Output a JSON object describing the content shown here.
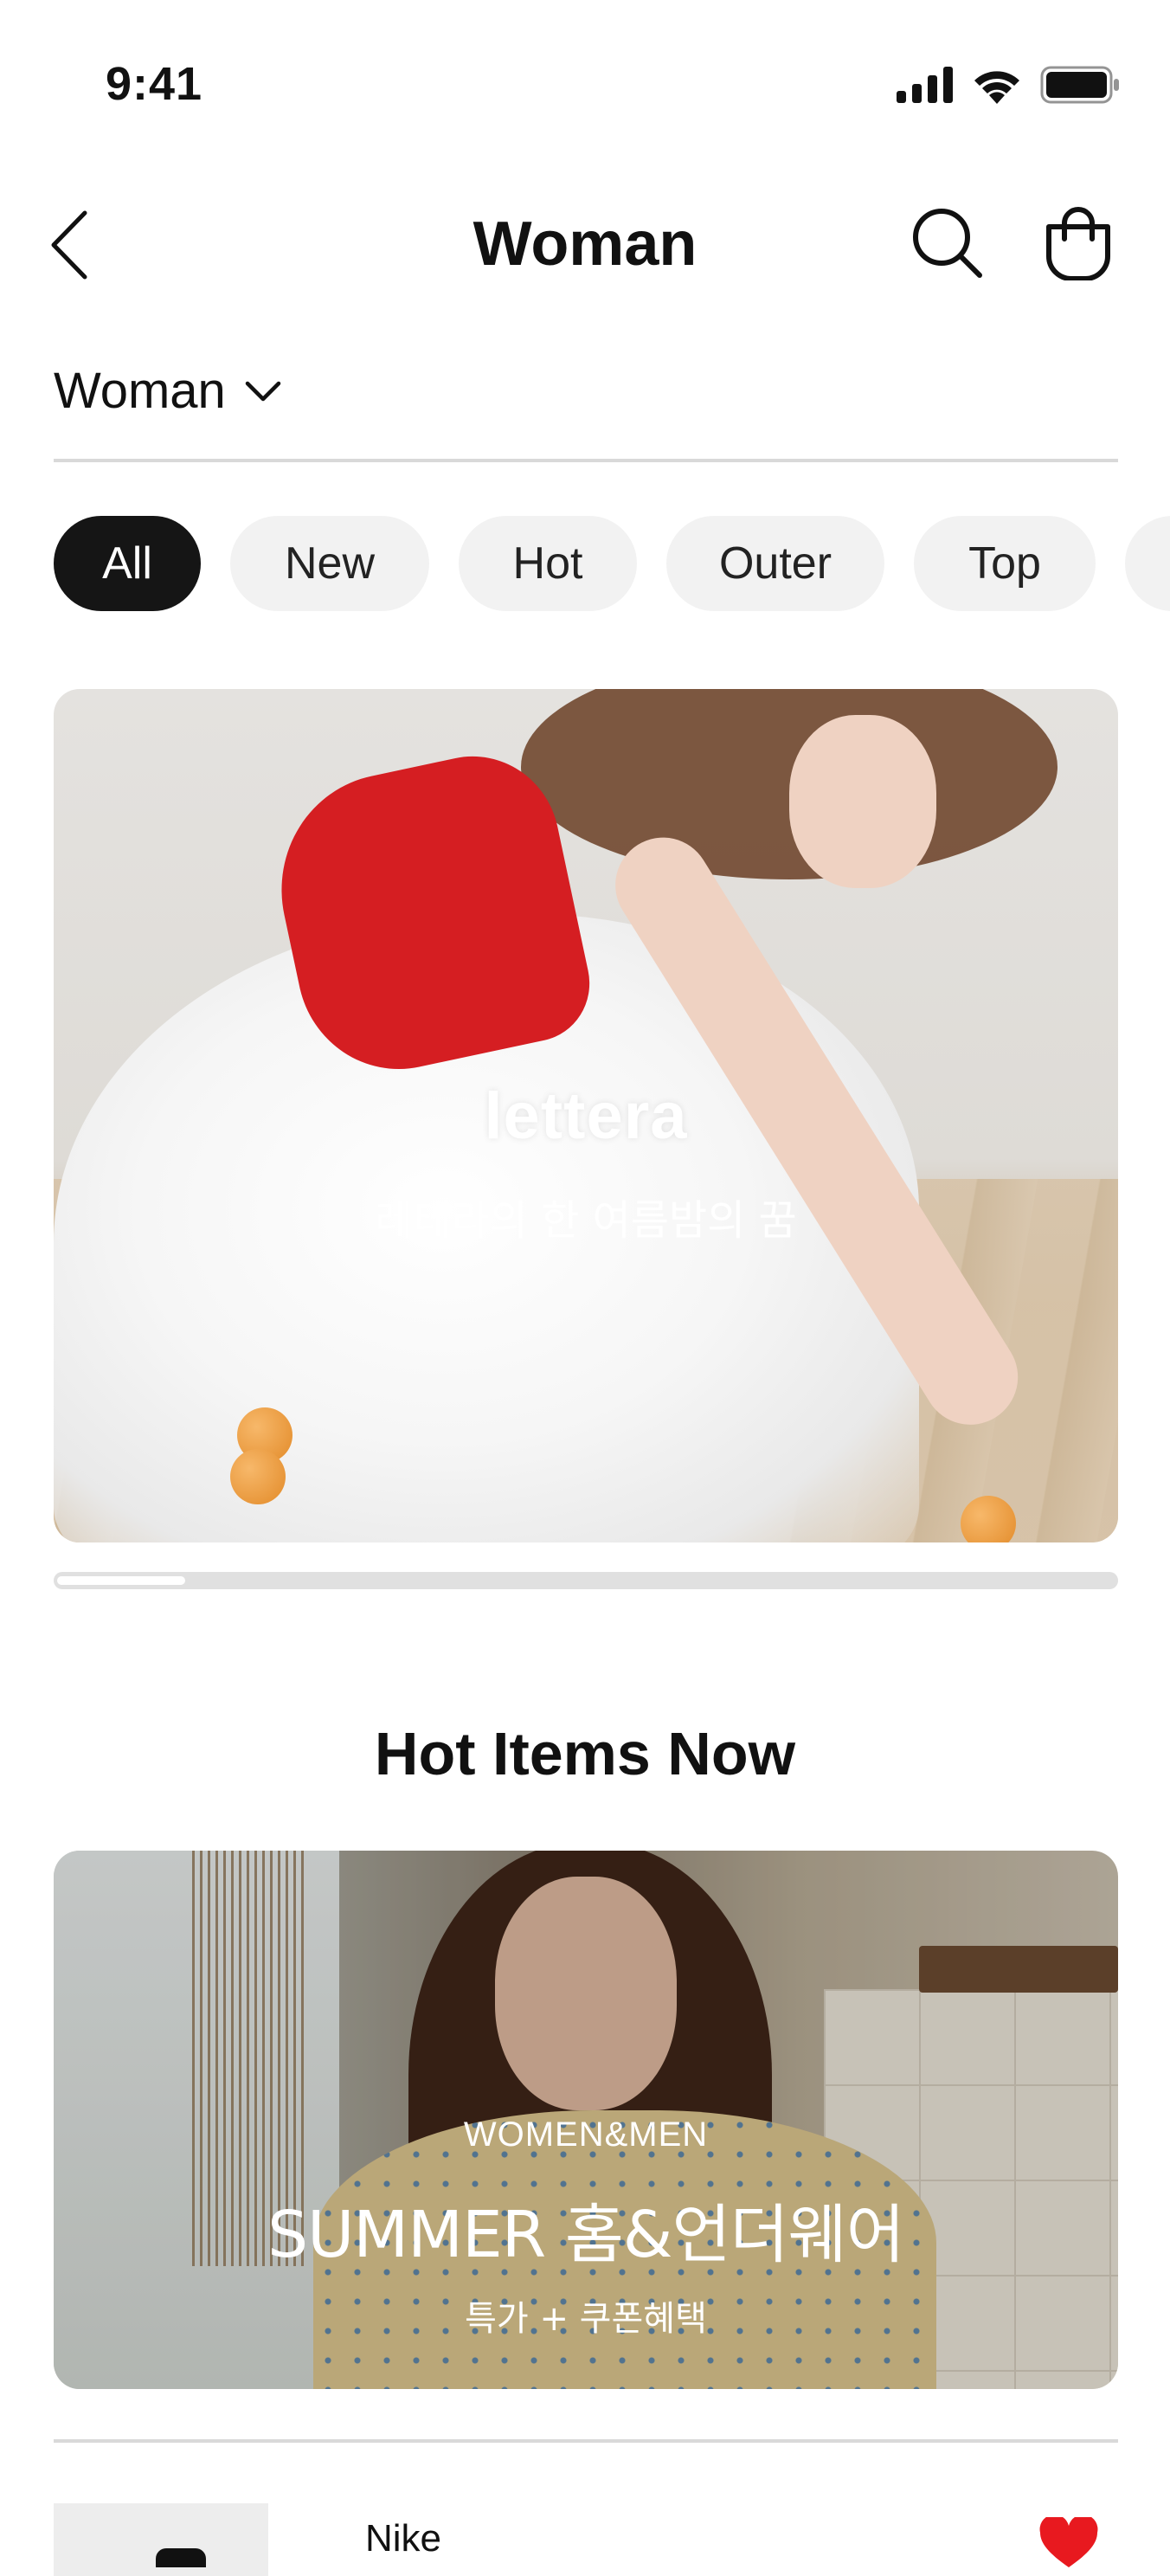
{
  "status_bar": {
    "time": "9:41"
  },
  "header": {
    "title": "Woman",
    "back_icon": "chevron-left-icon",
    "search_icon": "search-icon",
    "cart_icon": "shopping-bag-icon"
  },
  "category": {
    "selected": "Woman",
    "icon": "chevron-down-icon"
  },
  "chips": [
    {
      "label": "All",
      "active": true
    },
    {
      "label": "New",
      "active": false
    },
    {
      "label": "Hot",
      "active": false
    },
    {
      "label": "Outer",
      "active": false
    },
    {
      "label": "Top",
      "active": false
    }
  ],
  "hero_banner": {
    "brand": "lettera",
    "subtitle": "레테라의 한 여름밤의 꿈",
    "progress": 0.12
  },
  "hot_section": {
    "title": "Hot Items Now",
    "banner": {
      "kicker": "WOMEN&MEN",
      "title": "SUMMER 홈&언더웨어",
      "subtitle": "특가 + 쿠폰혜택"
    }
  },
  "product": {
    "brand": "Nike",
    "liked": true,
    "heart_icon": "heart-icon"
  },
  "colors": {
    "text": "#111111",
    "chip_bg": "#f2f2f2",
    "chip_active_bg": "#151515",
    "divider": "#d9d9d9",
    "heart": "#e8191f"
  }
}
